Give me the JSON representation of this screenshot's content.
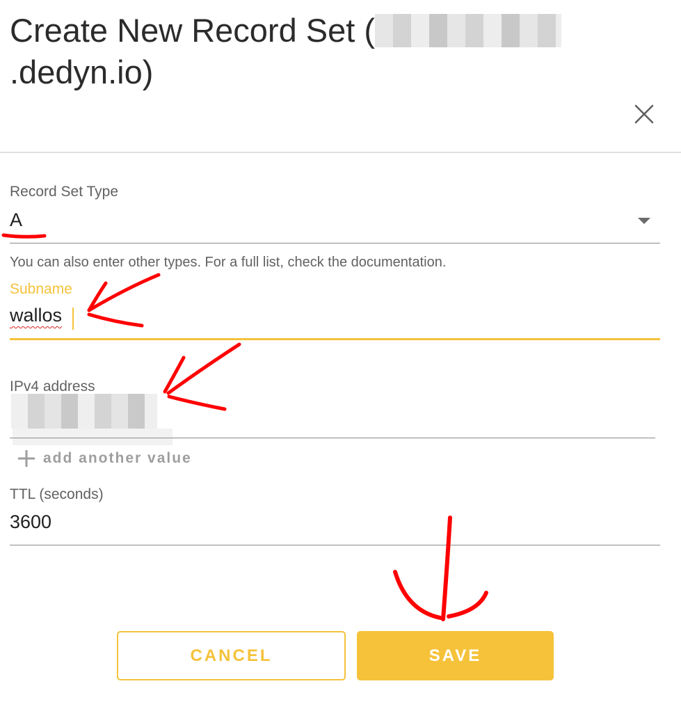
{
  "dialog": {
    "title_prefix": "Create New Record Set (",
    "title_suffix": ".dedyn.io)",
    "close_icon": "close-icon"
  },
  "form": {
    "record_type": {
      "label": "Record Set Type",
      "value": "A",
      "hint": "You can also enter other types. For a full list, check the documentation."
    },
    "subname": {
      "label": "Subname",
      "value": "wallos"
    },
    "ipv4": {
      "label": "IPv4 address",
      "value_redacted": true
    },
    "add_value_label": "add another value",
    "ttl": {
      "label": "TTL (seconds)",
      "value": "3600"
    }
  },
  "actions": {
    "cancel_label": "CANCEL",
    "save_label": "SAVE"
  },
  "colors": {
    "accent": "#f5c23a",
    "annotation": "#ff0000"
  }
}
